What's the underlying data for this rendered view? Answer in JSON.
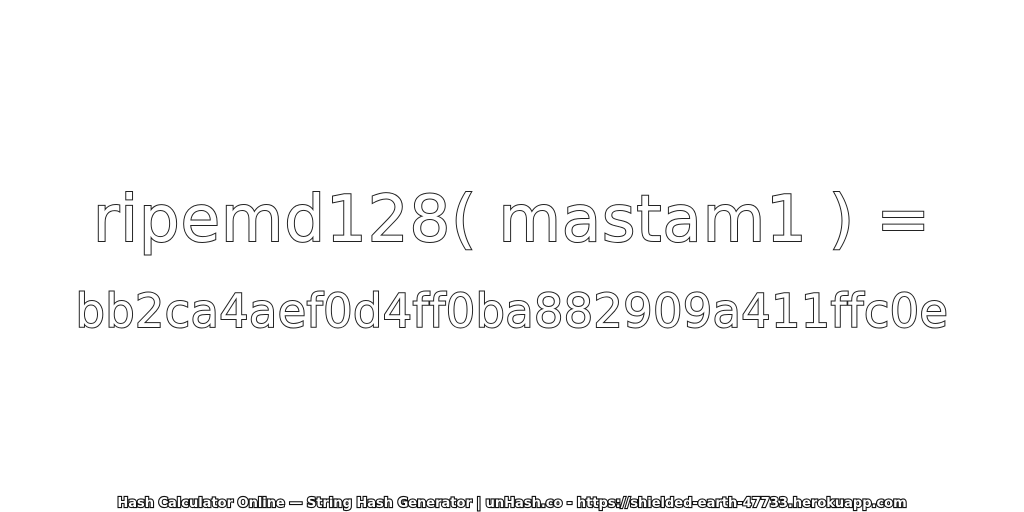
{
  "expression": "ripemd128( mastam1 ) =",
  "hash_value": "bb2ca4aef0d4ff0ba882909a411ffc0e",
  "footer": "Hash Calculator Online — String Hash Generator | unHash.co - https://shielded-earth-47733.herokuapp.com",
  "colors": {
    "background": "#ffffff",
    "text_fill": "#ffffff",
    "text_outline": "#222222"
  }
}
